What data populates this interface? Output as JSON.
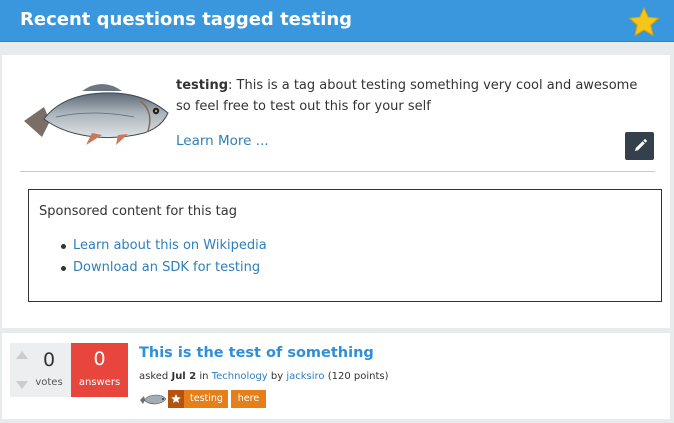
{
  "header": {
    "title": "Recent questions tagged testing",
    "favorite_icon": "star-icon",
    "accent_color": "#3a97dd"
  },
  "tag_info": {
    "image_icon": "fish-image",
    "tag_name": "testing",
    "separator": ":",
    "description": " This is a tag about testing something very cool and awesome so feel free to test out this for your self",
    "learn_more": "Learn More ...",
    "edit_icon": "pencil-icon"
  },
  "sponsored": {
    "title": "Sponsored content for this tag",
    "links": [
      "Learn about this on Wikipedia",
      "Download an SDK for testing"
    ]
  },
  "questions": [
    {
      "votes": "0",
      "votes_label": "votes",
      "answers": "0",
      "answers_label": "answers",
      "title": "This is the test of something",
      "asked": "asked",
      "date": "Jul 2",
      "in": "in",
      "category": "Technology",
      "by": "by",
      "user": "jacksiro",
      "points": "(120 points)",
      "tags": [
        "testing",
        "here"
      ],
      "answer_badge_color": "#e8463c",
      "tag_color": "#e57f19"
    }
  ]
}
